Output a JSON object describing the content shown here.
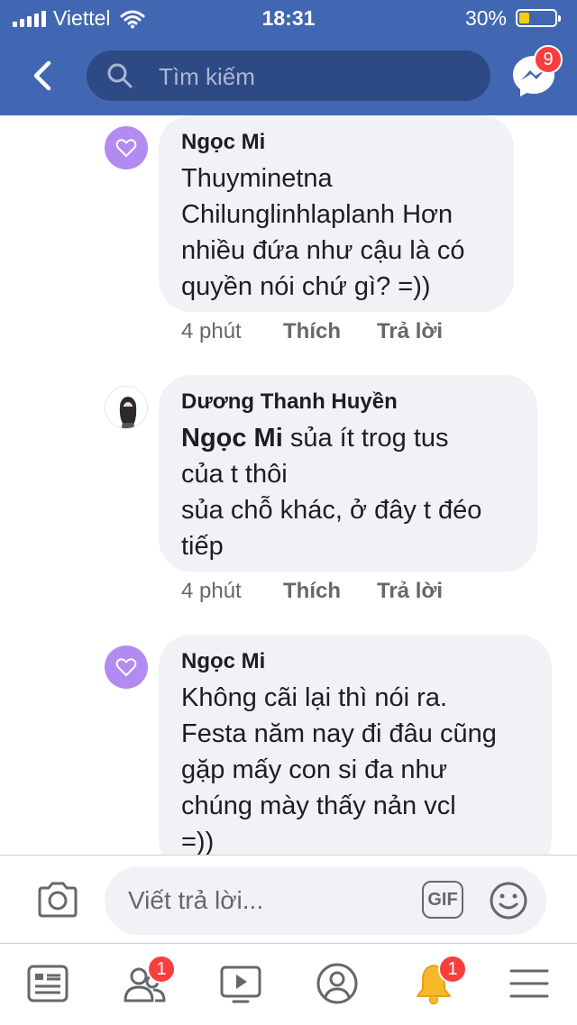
{
  "status_bar": {
    "carrier": "Viettel",
    "time": "18:31",
    "battery_percent": "30%",
    "battery_level": 0.3
  },
  "header": {
    "search_placeholder": "Tìm kiếm",
    "messenger_badge": "9"
  },
  "comments": [
    {
      "author": "Ngọc Mi",
      "mention": "",
      "text": "Thuyminetna\nChilunglinhlaplanh Hơn\nnhiều đứa như cậu là có\nquyền nói chứ gì? =))",
      "time": "4 phút",
      "like_label": "Thích",
      "reply_label": "Trả lời",
      "avatar": "heart-avatar"
    },
    {
      "author": "Dương Thanh Huyền",
      "mention": "Ngọc Mi",
      "text": " sủa ít trog tus\ncủa t thôi\nsủa chỗ khác, ở đây t đéo\ntiếp",
      "time": "4 phút",
      "like_label": "Thích",
      "reply_label": "Trả lời",
      "avatar": "photo-avatar"
    },
    {
      "author": "Ngọc Mi",
      "mention": "",
      "text": "Không cãi lại thì nói ra.\nFesta năm nay đi đâu cũng\ngặp mấy con si đa như\nchúng mày thấy nản vcl\n=))",
      "avatar": "heart-avatar"
    }
  ],
  "composer": {
    "placeholder": "Viết trả lời...",
    "gif_label": "GIF"
  },
  "tab_bar": {
    "friends_badge": "1",
    "notifications_badge": "1"
  },
  "colors": {
    "header": "#4267b2",
    "search_bg": "#2e4a84",
    "bubble": "#f0f2f5",
    "badge": "#fa3e3e",
    "heart_avatar": "#b18bef",
    "battery": "#ffcc00"
  }
}
